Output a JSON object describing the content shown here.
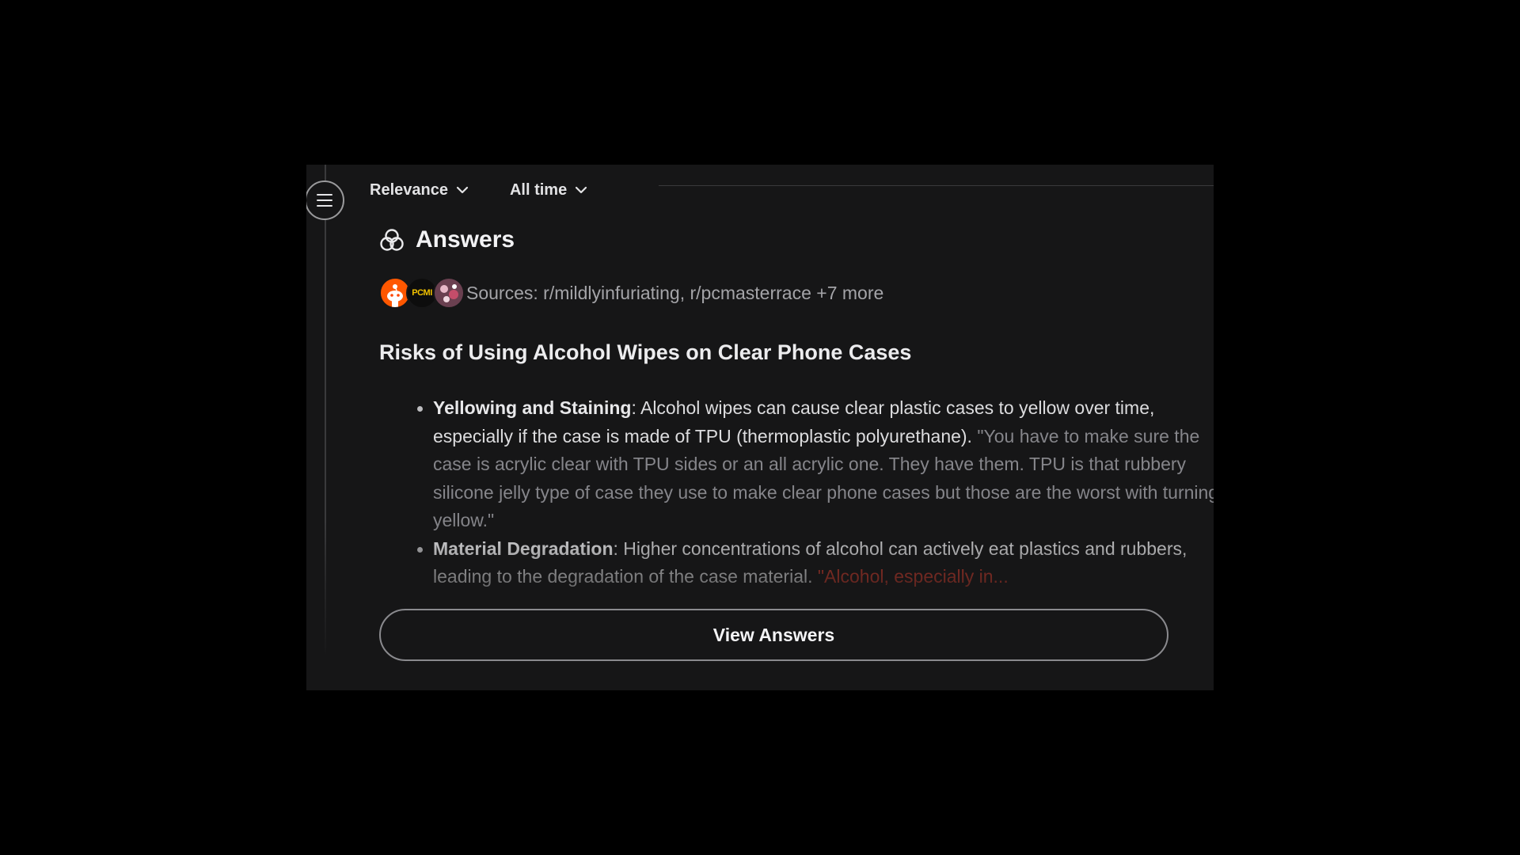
{
  "toolbar": {
    "sort_label": "Relevance",
    "time_label": "All time"
  },
  "answers": {
    "title": "Answers",
    "sources_text": "Sources: r/mildlyinfuriating, r/pcmasterrace +7 more",
    "avatar_icons": [
      "reddit-snoo-icon",
      "pcmr-icon",
      "mildlyinfuriating-icon"
    ],
    "avatar_pcm_text": "PCMI",
    "section_title": "Risks of Using Alcohol Wipes on Clear Phone Cases",
    "bullets": [
      {
        "term": "Yellowing and Staining",
        "text": ": Alcohol wipes can cause clear plastic cases to yellow over time, especially if the case is made of TPU (thermoplastic polyurethane). ",
        "quote": "\"You have to make sure the case is acrylic clear with TPU sides or an all acrylic one. They have them. TPU is that rubbery silicone jelly type of case they use to make clear phone cases but those are the worst with turning yellow.\""
      },
      {
        "term": "Material Degradation",
        "text": ": Higher concentrations of alcohol can actively eat plastics and rubbers, leading to the degradation of the case material. ",
        "quote": "\"Alcohol, especially in..."
      }
    ],
    "view_button": "View Answers"
  },
  "colors": {
    "background": "#000000",
    "panel": "#161617",
    "accent_quote_red": "#c0392b",
    "reddit_orange": "#ff5700"
  }
}
